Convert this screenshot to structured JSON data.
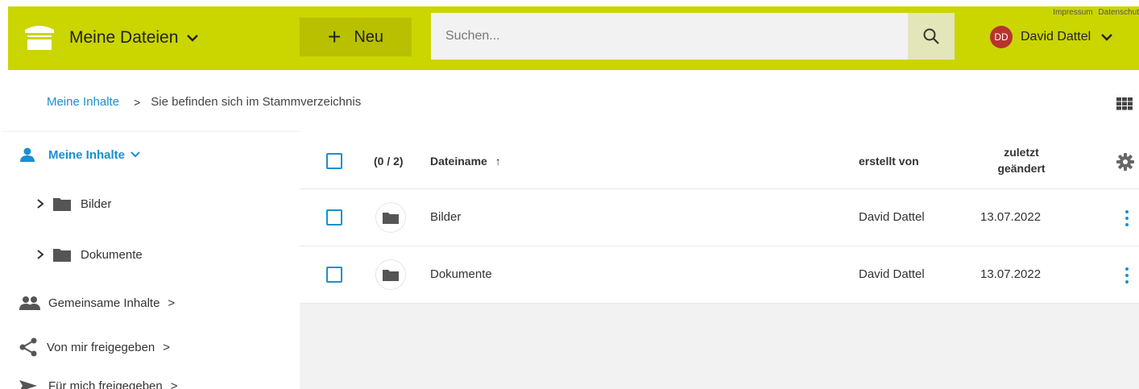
{
  "header": {
    "brand_title": "Meine Dateien",
    "new_button": {
      "icon": "+",
      "label": "Neu"
    },
    "search": {
      "placeholder": "Suchen...",
      "value": ""
    },
    "legal_links": [
      "Impressum",
      "Datenschut"
    ],
    "user": {
      "initials": "DD",
      "name": "David Dattel"
    }
  },
  "breadcrumb": {
    "root_link": "Meine Inhalte",
    "separator": ">",
    "current": "Sie befinden sich im Stammverzeichnis"
  },
  "sidebar": {
    "my_content": "Meine Inhalte",
    "folders": [
      "Bilder",
      "Dokumente"
    ],
    "shared": "Gemeinsame Inhalte",
    "shared_by_me": "Von mir freigegeben",
    "shared_with_me": "Für mich freigegeben",
    "chevron": ">"
  },
  "table": {
    "headers": {
      "count": "(0 / 2)",
      "filename": "Dateiname",
      "sort_arrow": "↑",
      "created_by": "erstellt von",
      "modified_line1": "zuletzt",
      "modified_line2": "geändert"
    },
    "rows": [
      {
        "name": "Bilder",
        "created_by": "David Dattel",
        "modified": "13.07.2022"
      },
      {
        "name": "Dokumente",
        "created_by": "David Dattel",
        "modified": "13.07.2022"
      }
    ]
  },
  "colors": {
    "header_bg": "#cbd500",
    "new_button_bg": "#b8c000",
    "accent": "#1a8fd1",
    "avatar_bg": "#b8332f"
  },
  "icons": [
    "cloud-folder-logo",
    "chevron-down-icon",
    "plus-icon",
    "search-icon",
    "grid-view-icon",
    "person-icon",
    "folder-icon",
    "chevron-right-icon",
    "people-icon",
    "share-icon",
    "send-icon",
    "gear-icon",
    "kebab-menu-icon"
  ]
}
